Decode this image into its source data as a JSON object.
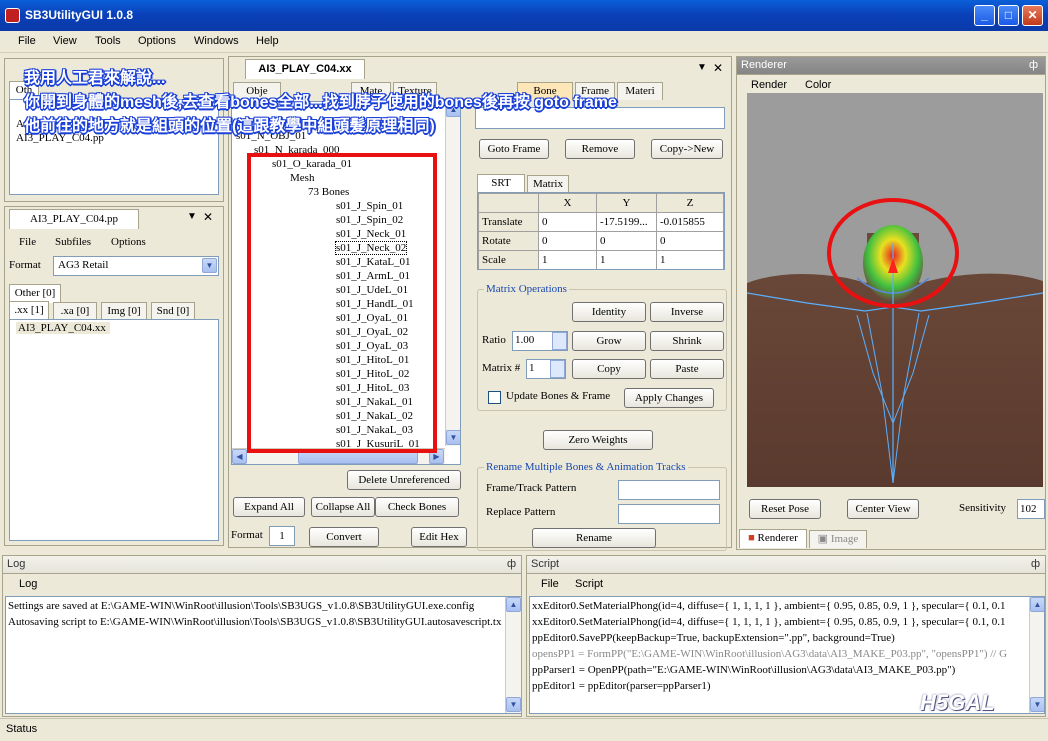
{
  "window": {
    "title": "SB3UtilityGUI 1.0.8",
    "minimize": "_",
    "maximize": "□",
    "close": "✕"
  },
  "menu": [
    "File",
    "View",
    "Tools",
    "Options",
    "Windows",
    "Help"
  ],
  "overlay_text": [
    "我用人工君來解說...",
    "你開到身體的mesh後,去查看bones全部...找到脖子使用的bones後再按 goto frame",
    "他前往的地方就是組頭的位置(這跟教學中組頭髮原理相同)"
  ],
  "left_top": {
    "tab": "Oth",
    "list_items": [
      "Ar",
      "AI3_PLAY_C04.pp"
    ]
  },
  "pp_panel": {
    "title": "AI3_PLAY_C04.pp",
    "pin": "▼",
    "close": "✕",
    "menu": [
      "File",
      "Subfiles",
      "Options"
    ],
    "format_label": "Format",
    "format_value": "AG3 Retail",
    "other_tab": "Other [0]",
    "tabs": [
      ".xx [1]",
      ".xa [0]",
      "Img [0]",
      "Snd [0]"
    ],
    "files": [
      "AI3_PLAY_C04.xx"
    ]
  },
  "xx_editor": {
    "doc_tab": "AI3_PLAY_C04.xx",
    "tabs": [
      "Obje",
      "Mate",
      "Texture"
    ],
    "tree": [
      {
        "text": "s01_N_OBJ_01",
        "indent": 0,
        "exp": "-"
      },
      {
        "text": "s01_N_karada_000",
        "indent": 1,
        "exp": "-"
      },
      {
        "text": "s01_O_karada_01",
        "indent": 2,
        "exp": "-"
      },
      {
        "text": "Mesh",
        "indent": 3,
        "exp": "-"
      },
      {
        "text": "73 Bones",
        "indent": 4,
        "exp": "-"
      }
    ],
    "bones": [
      "s01_J_Spin_01",
      "s01_J_Spin_02",
      "s01_J_Neck_01",
      "s01_J_Neck_02",
      "s01_J_KataL_01",
      "s01_J_ArmL_01",
      "s01_J_UdeL_01",
      "s01_J_HandL_01",
      "s01_J_OyaL_01",
      "s01_J_OyaL_02",
      "s01_J_OyaL_03",
      "s01_J_HitoL_01",
      "s01_J_HitoL_02",
      "s01_J_HitoL_03",
      "s01_J_NakaL_01",
      "s01_J_NakaL_02",
      "s01_J_NakaL_03",
      "s01_J_KusuriL_01"
    ],
    "selected_bone": "s01_J_Neck_02",
    "delete_unref": "Delete Unreferenced",
    "expand_all": "Expand All",
    "collapse_all": "Collapse All",
    "check_bones": "Check Bones",
    "format_label": "Format",
    "format_value": "1",
    "convert": "Convert",
    "edit_hex": "Edit Hex"
  },
  "bone_editor": {
    "tabs": [
      "Bone",
      "Frame",
      "Materi"
    ],
    "goto_frame": "Goto Frame",
    "remove": "Remove",
    "copy_new": "Copy->New",
    "srt_tabs": [
      "SRT",
      "Matrix"
    ],
    "grid_headers": [
      "",
      "X",
      "Y",
      "Z"
    ],
    "grid_rows": [
      {
        "label": "Translate",
        "x": "0",
        "y": "-17.5199...",
        "z": "-0.015855"
      },
      {
        "label": "Rotate",
        "x": "0",
        "y": "0",
        "z": "0"
      },
      {
        "label": "Scale",
        "x": "1",
        "y": "1",
        "z": "1"
      }
    ],
    "matrix_ops_title": "Matrix Operations",
    "identity": "Identity",
    "inverse": "Inverse",
    "ratio_label": "Ratio",
    "ratio_value": "1.00",
    "grow": "Grow",
    "shrink": "Shrink",
    "matrix_num_label": "Matrix #",
    "matrix_num_value": "1",
    "copy": "Copy",
    "paste": "Paste",
    "update_bones_label": "Update Bones & Frame",
    "apply_changes": "Apply Changes",
    "zero_weights": "Zero Weights",
    "rename_title": "Rename Multiple Bones & Animation Tracks",
    "frame_track_label": "Frame/Track Pattern",
    "replace_label": "Replace Pattern",
    "rename": "Rename"
  },
  "renderer": {
    "title": "Renderer",
    "pin": "ф",
    "menu": [
      "Render",
      "Color"
    ],
    "reset_pose": "Reset Pose",
    "center_view": "Center View",
    "sensitivity_label": "Sensitivity",
    "sensitivity_value": "102",
    "tabs": [
      "Renderer",
      "Image"
    ]
  },
  "log": {
    "title": "Log",
    "pin": "ф",
    "menu": "Log",
    "lines": [
      "Settings are saved at E:\\GAME-WIN\\WinRoot\\illusion\\Tools\\SB3UGS_v1.0.8\\SB3UtilityGUI.exe.config",
      "Autosaving script to E:\\GAME-WIN\\WinRoot\\illusion\\Tools\\SB3UGS_v1.0.8\\SB3UtilityGUI.autosavescript.tx"
    ]
  },
  "script": {
    "title": "Script",
    "pin": "ф",
    "menu": [
      "File",
      "Script"
    ],
    "lines": [
      "xxEditor0.SetMaterialPhong(id=4, diffuse={ 1, 1, 1, 1 }, ambient={ 0.95, 0.85, 0.9, 1 }, specular={ 0.1, 0.1",
      "xxEditor0.SetMaterialPhong(id=4, diffuse={ 1, 1, 1, 1 }, ambient={ 0.95, 0.85, 0.9, 1 }, specular={ 0.1, 0.1",
      "ppEditor0.SavePP(keepBackup=True, backupExtension=\".pp\", background=True)",
      "opensPP1 = FormPP(\"E:\\GAME-WIN\\WinRoot\\illusion\\AG3\\data\\AI3_MAKE_P03.pp\", \"opensPP1\") // G",
      "ppParser1 = OpenPP(path=\"E:\\GAME-WIN\\WinRoot\\illusion\\AG3\\data\\AI3_MAKE_P03.pp\")",
      "ppEditor1 = ppEditor(parser=ppParser1)"
    ]
  },
  "statusbar": {
    "text": "Status"
  },
  "watermark": "H5GAL"
}
